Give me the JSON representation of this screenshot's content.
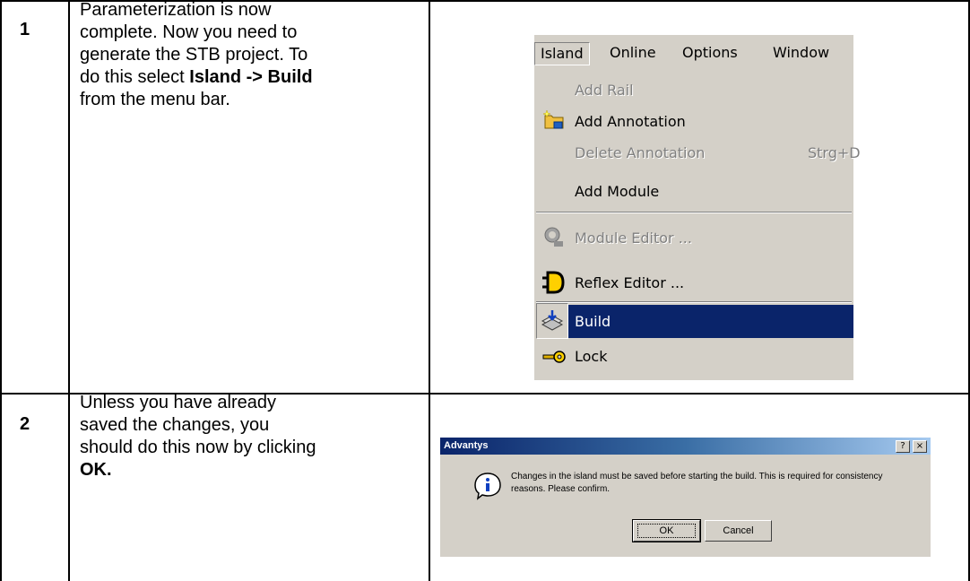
{
  "rows": [
    {
      "number": "1",
      "text_lines": [
        "Parameterization is now",
        "complete. Now you need to",
        "generate the STB project. To"
      ],
      "line4_before": "do this select ",
      "line4_bold": "Island -> Build",
      "line5": "from the menu bar."
    },
    {
      "number": "2",
      "text_lines": [
        "Unless you have already",
        "saved the changes, you",
        "should do this now by clicking"
      ],
      "bold_line": "OK."
    }
  ],
  "menu_screenshot": {
    "menubar": [
      "Island",
      "Online",
      "Options",
      "Window"
    ],
    "active_menu": "Island",
    "items": [
      {
        "label": "Add Rail",
        "enabled": false,
        "icon": ""
      },
      {
        "label": "Add Annotation",
        "enabled": true,
        "icon": "folder-new-icon"
      },
      {
        "label": "Delete Annotation",
        "shortcut": "Strg+D",
        "enabled": false,
        "icon": ""
      },
      {
        "label": "Add Module",
        "enabled": true,
        "icon": ""
      },
      {
        "label": "Module Editor ...",
        "enabled": false,
        "icon": "module-editor-icon"
      },
      {
        "label": "Reflex Editor ...",
        "enabled": true,
        "icon": "reflex-editor-icon"
      },
      {
        "label": "Build",
        "enabled": true,
        "highlighted": true,
        "icon": "build-icon"
      },
      {
        "label": "Lock",
        "enabled": true,
        "icon": "key-icon"
      }
    ],
    "colors": {
      "menu_bg": "#d4d0c8",
      "highlight": "#0a246a",
      "disabled": "#808080"
    }
  },
  "dialog_screenshot": {
    "title": "Advantys",
    "message": "Changes in the island must be saved before starting the build. This is required for consistency reasons. Please confirm.",
    "buttons": [
      "OK",
      "Cancel"
    ],
    "icon": "info-icon",
    "title_buttons": [
      "help-icon",
      "close-icon"
    ]
  }
}
